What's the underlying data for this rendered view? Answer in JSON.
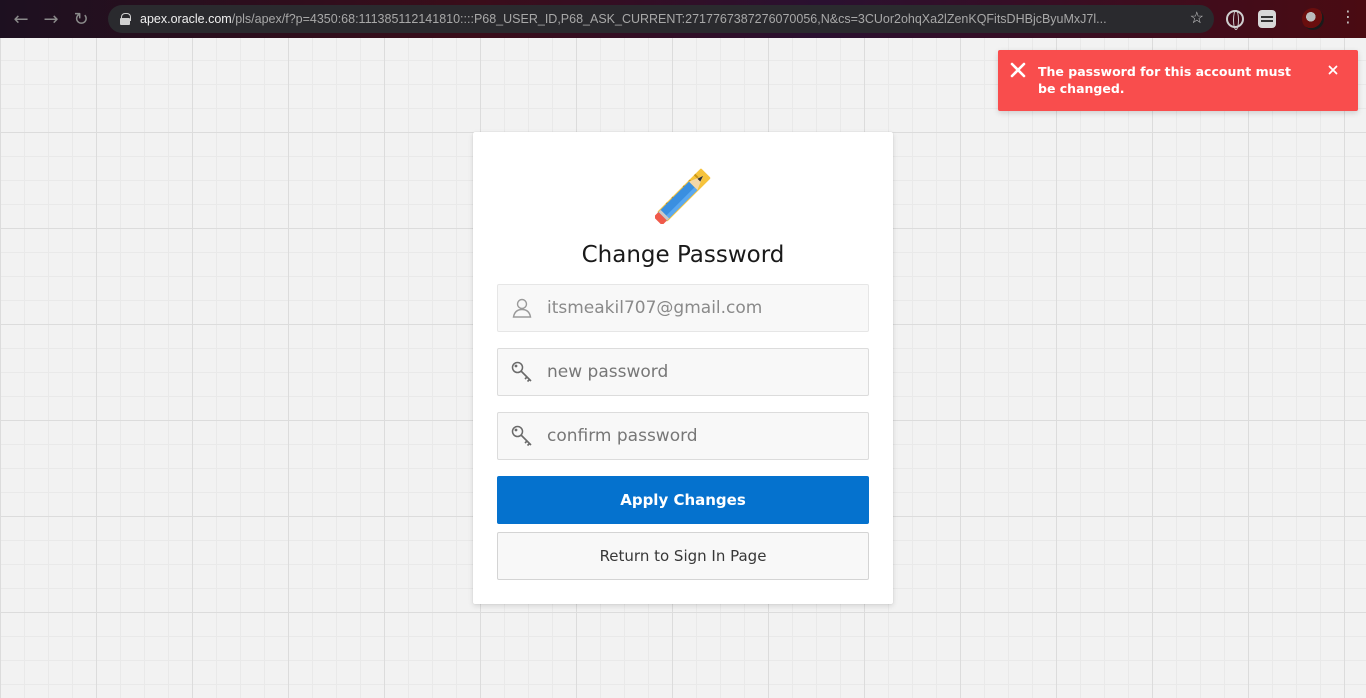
{
  "browser": {
    "url_host": "apex.oracle.com",
    "url_rest": "/pls/apex/f?p=4350:68:111385112141810::::P68_USER_ID,P68_ASK_CURRENT:2717767387276070056,N&cs=3CUor2ohqXa2lZenKQFitsDHBjcByuMxJ7l..."
  },
  "alert": {
    "message": "The password for this account must be changed.",
    "color": "#f94d4d"
  },
  "card": {
    "title": "Change Password",
    "username_value": "itsmeakil707@gmail.com",
    "new_password_placeholder": "new password",
    "confirm_password_placeholder": "confirm password",
    "apply_label": "Apply Changes",
    "return_label": "Return to Sign In Page",
    "accent_color": "#0572ce"
  }
}
